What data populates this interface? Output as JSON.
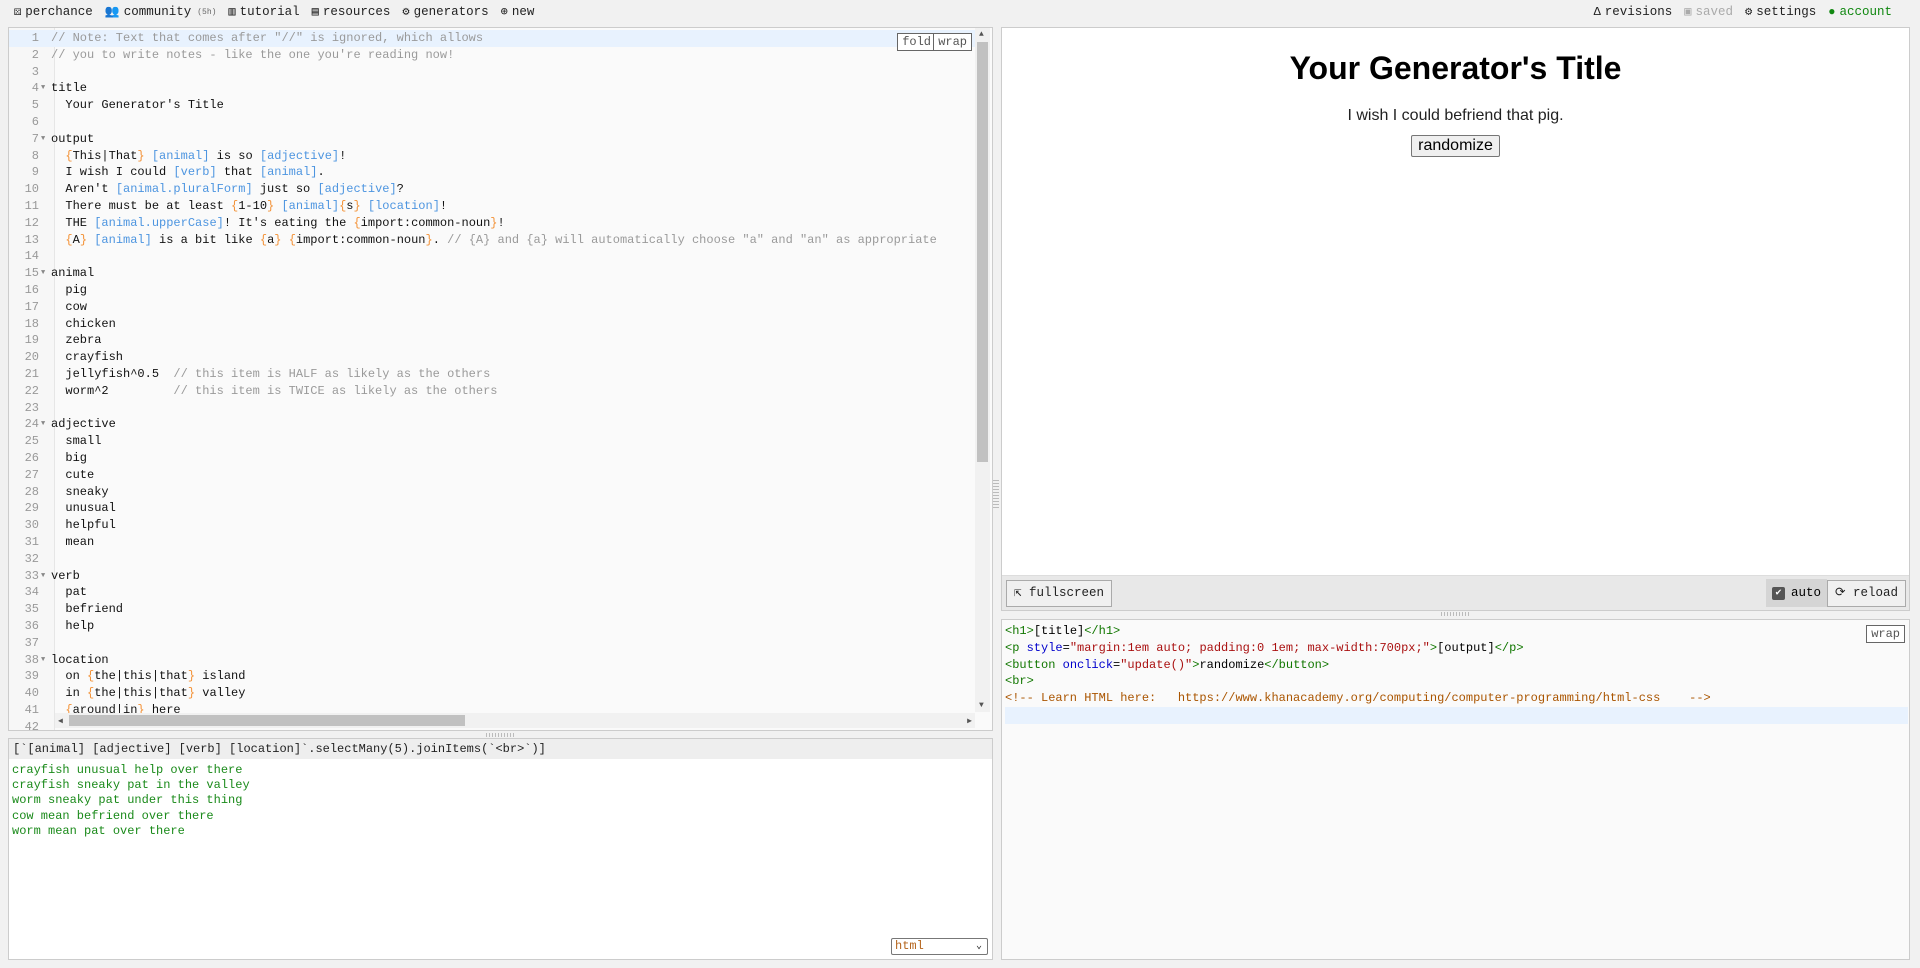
{
  "topbar": {
    "left": [
      {
        "label": "perchance",
        "icon": "dice-icon",
        "glyph": "⚄"
      },
      {
        "label": "community",
        "badge": "(5h)",
        "icon": "people-icon",
        "glyph": "👥"
      },
      {
        "label": "tutorial",
        "icon": "books-icon",
        "glyph": "▥"
      },
      {
        "label": "resources",
        "icon": "briefcase-icon",
        "glyph": "▤"
      },
      {
        "label": "generators",
        "icon": "gears-icon",
        "glyph": "⚙"
      },
      {
        "label": "new",
        "icon": "plus-circle-icon",
        "glyph": "⊕"
      }
    ],
    "right": [
      {
        "label": "revisions",
        "icon": "delta-icon",
        "glyph": "Δ",
        "color": "#222222"
      },
      {
        "label": "saved",
        "icon": "save-icon",
        "glyph": "▣",
        "color": "#aaaaaa"
      },
      {
        "label": "settings",
        "icon": "gear-icon",
        "glyph": "⚙",
        "color": "#222222"
      },
      {
        "label": "account",
        "icon": "person-icon",
        "glyph": "●",
        "color": "#118811"
      }
    ]
  },
  "editor": {
    "fold_label": "fold",
    "wrap_label": "wrap",
    "lines": [
      "// Note: Text that comes after \"//\" is ignored, which allows",
      "// you to write notes - like the one you're reading now!",
      "",
      "title",
      "  Your Generator's Title",
      "",
      "output",
      "  {This|That} [animal] is so [adjective]!",
      "  I wish I could [verb] that [animal].",
      "  Aren't [animal.pluralForm] just so [adjective]?",
      "  There must be at least {1-10} [animal]{s} [location]!",
      "  THE [animal.upperCase]! It's eating the {import:common-noun}!",
      "  {A} [animal] is a bit like {a} {import:common-noun}. // {A} and {a} will automatically choose \"a\" and \"an\" as appropriate",
      "",
      "animal",
      "  pig",
      "  cow",
      "  chicken",
      "  zebra",
      "  crayfish",
      "  jellyfish^0.5  // this item is HALF as likely as the others",
      "  worm^2         // this item is TWICE as likely as the others",
      "",
      "adjective",
      "  small",
      "  big",
      "  cute",
      "  sneaky",
      "  unusual",
      "  helpful",
      "  mean",
      "",
      "verb",
      "  pat",
      "  befriend",
      "  help",
      "",
      "location",
      "  on {the|this|that} island",
      "  in {the|this|that} valley",
      "  {around|in} here"
    ],
    "last_partial_line_number": "42"
  },
  "console": {
    "input": "[`[animal] [adjective] [verb] [location]`.selectMany(5).joinItems(`<br>`)]",
    "output": [
      "crayfish unusual help over there",
      "crayfish sneaky pat in the valley",
      "worm sneaky pat under this thing",
      "cow mean befriend over there",
      "worm mean pat over there"
    ],
    "mode": "html"
  },
  "preview": {
    "title": "Your Generator's Title",
    "output": "I wish I could befriend that pig.",
    "button": "randomize",
    "fullscreen_label": "fullscreen",
    "auto_label": "auto",
    "auto_checked": true,
    "reload_label": "reload"
  },
  "html_editor": {
    "wrap_label": "wrap",
    "lines": [
      "<h1>[title]</h1>",
      "<p style=\"margin:1em auto; padding:0 1em; max-width:700px;\">[output]</p>",
      "<button onclick=\"update()\">randomize</button>",
      "<br>",
      "<!-- Learn HTML here:   https://www.khanacademy.org/computing/computer-programming/html-css    -->",
      ""
    ]
  }
}
